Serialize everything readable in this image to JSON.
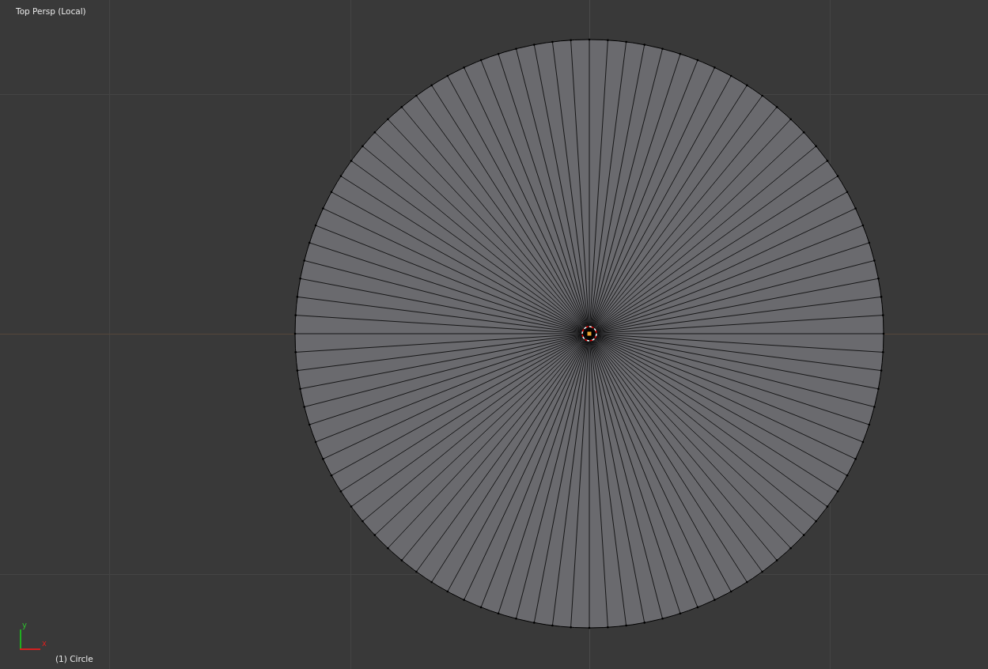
{
  "viewport": {
    "view_label": "Top Persp (Local)",
    "object_label": "(1) Circle",
    "axis_labels": {
      "x": "x",
      "y": "y"
    }
  }
}
